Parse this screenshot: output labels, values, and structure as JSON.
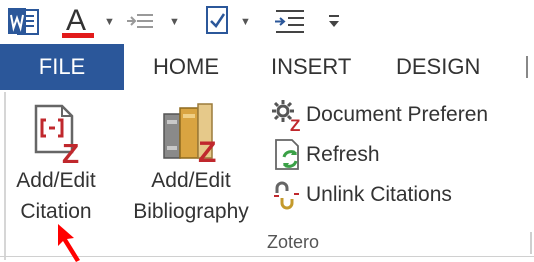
{
  "quick_access": {
    "icons": [
      "word-app-icon",
      "font-color-icon",
      "indent-list-icon",
      "check-document-icon",
      "arrow-list-icon",
      "customize-toolbar-icon"
    ],
    "font_letter": "A",
    "accent_colors": {
      "word_blue": "#2b579a",
      "font_red": "#e21b1b"
    }
  },
  "tabs": {
    "file": "FILE",
    "home": "HOME",
    "insert": "INSERT",
    "design": "DESIGN"
  },
  "ribbon": {
    "citation_button": {
      "line1": "Add/Edit",
      "line2": "Citation"
    },
    "bibliography_button": {
      "line1": "Add/Edit",
      "line2": "Bibliography"
    },
    "document_preferences": "Document Preferen",
    "refresh": "Refresh",
    "unlink_citations": "Unlink Citations",
    "group_label": "Zotero",
    "zotero_color": "#c0282d"
  },
  "annotation": {
    "arrow_color": "#ff0000",
    "points_to": "Add/Edit Citation"
  }
}
